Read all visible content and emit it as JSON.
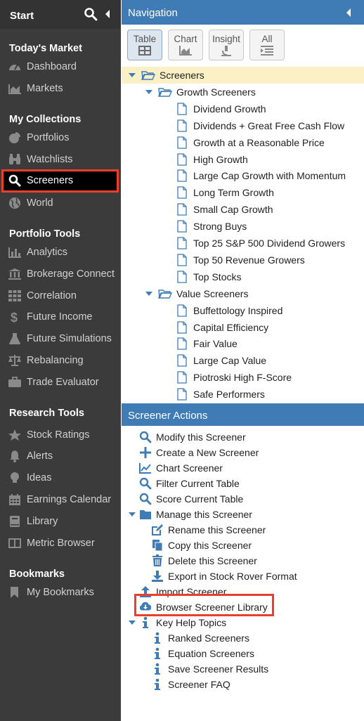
{
  "sidebar": {
    "title": "Start",
    "sections": [
      {
        "heading": "Today's Market",
        "items": [
          {
            "label": "Dashboard",
            "icon": "gauge-icon"
          },
          {
            "label": "Markets",
            "icon": "area-chart-icon"
          }
        ]
      },
      {
        "heading": "My Collections",
        "items": [
          {
            "label": "Portfolios",
            "icon": "pie-chart-icon"
          },
          {
            "label": "Watchlists",
            "icon": "binoculars-icon"
          },
          {
            "label": "Screeners",
            "icon": "search-icon",
            "active": true
          },
          {
            "label": "World",
            "icon": "globe-icon"
          }
        ]
      },
      {
        "heading": "Portfolio Tools",
        "items": [
          {
            "label": "Analytics",
            "icon": "bar-chart-icon"
          },
          {
            "label": "Brokerage Connect",
            "icon": "bank-icon"
          },
          {
            "label": "Correlation",
            "icon": "grid-icon"
          },
          {
            "label": "Future Income",
            "icon": "dollar-icon"
          },
          {
            "label": "Future Simulations",
            "icon": "flask-icon"
          },
          {
            "label": "Rebalancing",
            "icon": "balance-icon"
          },
          {
            "label": "Trade Evaluator",
            "icon": "briefcase-icon"
          }
        ]
      },
      {
        "heading": "Research Tools",
        "items": [
          {
            "label": "Stock Ratings",
            "icon": "star-icon"
          },
          {
            "label": "Alerts",
            "icon": "bell-icon"
          },
          {
            "label": "Ideas",
            "icon": "lightbulb-icon"
          },
          {
            "label": "Earnings Calendar",
            "icon": "calendar-icon"
          },
          {
            "label": "Library",
            "icon": "book-icon"
          },
          {
            "label": "Metric Browser",
            "icon": "columns-icon"
          }
        ]
      },
      {
        "heading": "Bookmarks",
        "items": [
          {
            "label": "My Bookmarks",
            "icon": "bookmark-icon"
          }
        ]
      }
    ]
  },
  "navigation": {
    "title": "Navigation",
    "tabs": [
      {
        "label": "Table",
        "active": true
      },
      {
        "label": "Chart"
      },
      {
        "label": "Insight"
      },
      {
        "label": "All"
      }
    ],
    "tree": {
      "root": "Screeners",
      "groups": [
        {
          "label": "Growth Screeners",
          "items": [
            "Dividend Growth",
            "Dividends + Great Free Cash Flow",
            "Growth at a Reasonable Price",
            "High Growth",
            "Large Cap Growth with Momentum",
            "Long Term Growth",
            "Small Cap Growth",
            "Strong Buys",
            "Top 25 S&P 500 Dividend Growers",
            "Top 50 Revenue Growers",
            "Top Stocks"
          ]
        },
        {
          "label": "Value Screeners",
          "items": [
            "Buffettology Inspired",
            "Capital Efficiency",
            "Fair Value",
            "Large Cap Value",
            "Piotroski High F-Score",
            "Safe Performers"
          ]
        }
      ]
    }
  },
  "screener_actions": {
    "title": "Screener Actions",
    "items": [
      {
        "label": "Modify this Screener",
        "icon": "search-icon",
        "level": 0
      },
      {
        "label": "Create a New Screener",
        "icon": "plus-icon",
        "level": 0
      },
      {
        "label": "Chart Screener",
        "icon": "line-chart-icon",
        "level": 0
      },
      {
        "label": "Filter Current Table",
        "icon": "search-icon",
        "level": 0
      },
      {
        "label": "Score Current Table",
        "icon": "search-icon",
        "level": 0
      },
      {
        "label": "Manage this Screener",
        "icon": "folder-icon",
        "level": 0,
        "expandable": true
      },
      {
        "label": "Rename this Screener",
        "icon": "edit-icon",
        "level": 1
      },
      {
        "label": "Copy this Screener",
        "icon": "copy-icon",
        "level": 1
      },
      {
        "label": "Delete this Screener",
        "icon": "trash-icon",
        "level": 1
      },
      {
        "label": "Export in Stock Rover Format",
        "icon": "download-icon",
        "level": 1
      },
      {
        "label": "Import Screener",
        "icon": "upload-icon",
        "level": 0
      },
      {
        "label": "Browser Screener Library",
        "icon": "cloud-download-icon",
        "level": 0,
        "highlighted": true
      },
      {
        "label": "Key Help Topics",
        "icon": "info-icon",
        "level": 0,
        "expandable": true
      },
      {
        "label": "Ranked Screeners",
        "icon": "info-icon",
        "level": 1
      },
      {
        "label": "Equation Screeners",
        "icon": "info-icon",
        "level": 1
      },
      {
        "label": "Save Screener Results",
        "icon": "info-icon",
        "level": 1
      },
      {
        "label": "Screener FAQ",
        "icon": "info-icon",
        "level": 1
      }
    ]
  },
  "colors": {
    "sidebar_bg": "#3b3b3b",
    "header_blue": "#3f7bb5",
    "highlight_red": "#e8402c",
    "selection_yellow": "#fbf0c6"
  }
}
